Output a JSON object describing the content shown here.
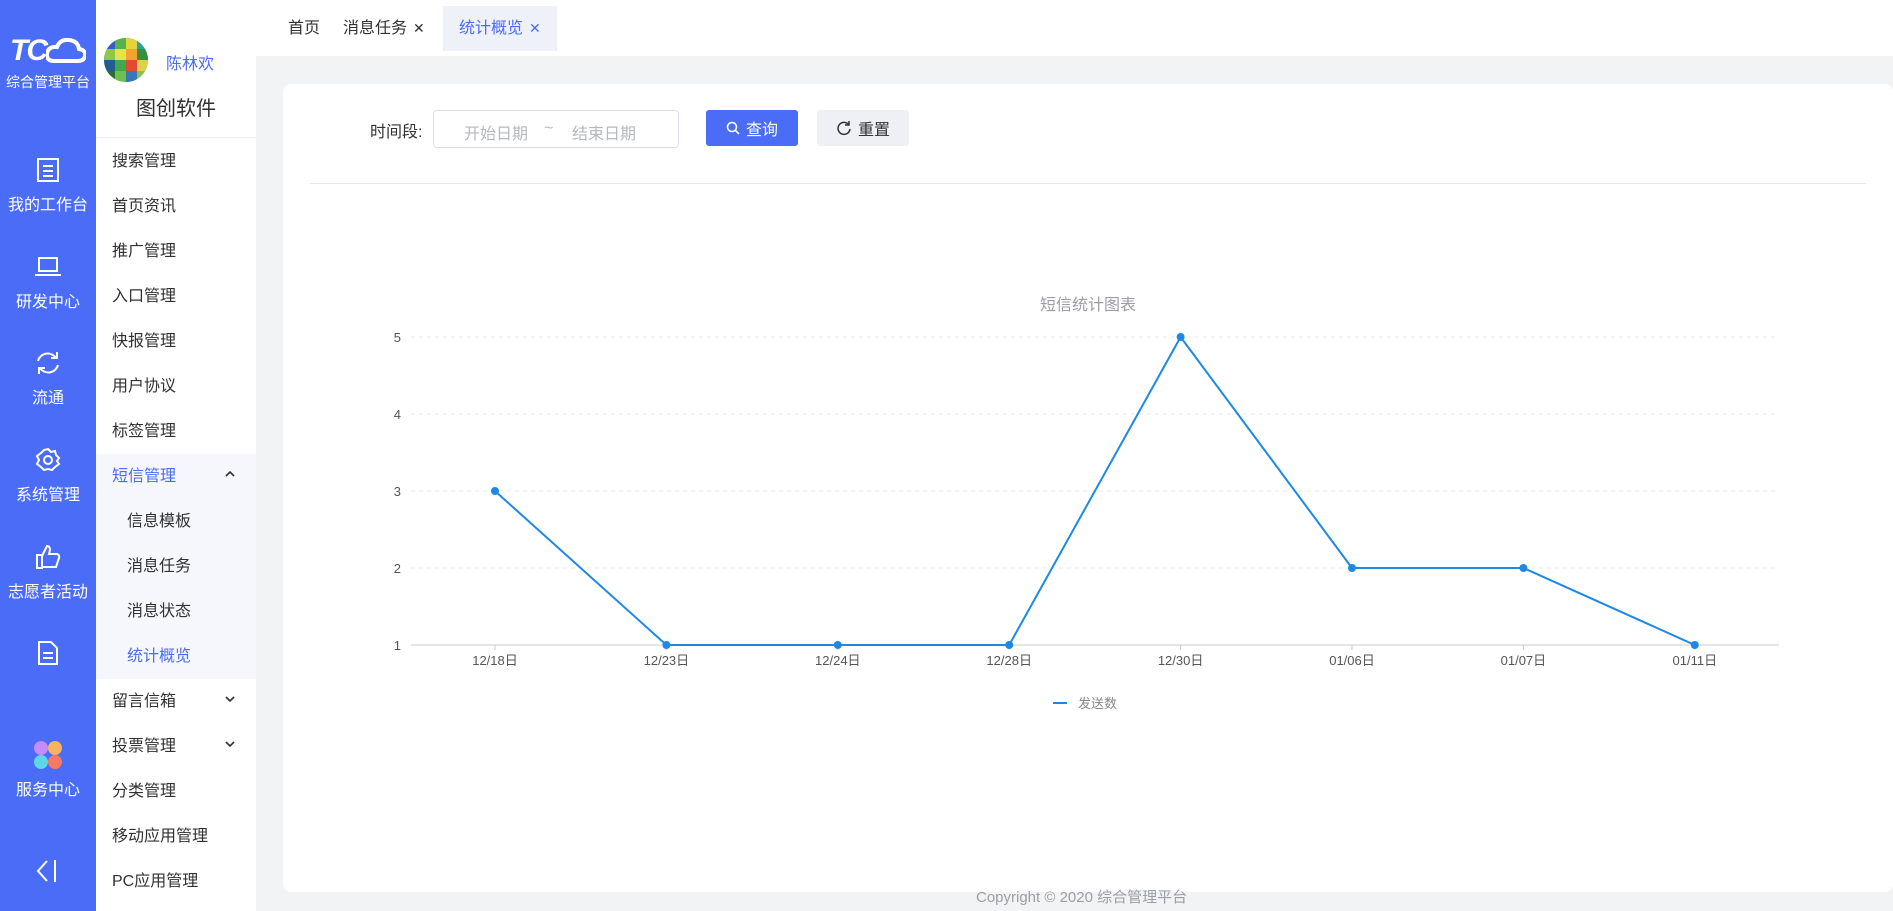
{
  "rail": {
    "logo_text": "TC",
    "app_name": "综合管理平台",
    "items": [
      {
        "label": "我的工作台",
        "icon": "dashboard-icon"
      },
      {
        "label": "研发中心",
        "icon": "laptop-icon"
      },
      {
        "label": "流通",
        "icon": "refresh-icon"
      },
      {
        "label": "系统管理",
        "icon": "gear-icon"
      },
      {
        "label": "志愿者活动",
        "icon": "thumbs-up-icon"
      },
      {
        "label": "",
        "icon": "document-icon"
      },
      {
        "label": "服务中心",
        "icon": "apps-icon"
      }
    ]
  },
  "user": {
    "name": "陈林欢",
    "company": "图创软件"
  },
  "menu": {
    "items": [
      {
        "label": "搜索管理"
      },
      {
        "label": "首页资讯"
      },
      {
        "label": "推广管理"
      },
      {
        "label": "入口管理"
      },
      {
        "label": "快报管理"
      },
      {
        "label": "用户协议"
      },
      {
        "label": "标签管理"
      },
      {
        "label": "短信管理",
        "state": "expanded"
      },
      {
        "label": "信息模板",
        "sub": true
      },
      {
        "label": "消息任务",
        "sub": true
      },
      {
        "label": "消息状态",
        "sub": true
      },
      {
        "label": "统计概览",
        "sub": true,
        "active": true
      },
      {
        "label": "留言信箱",
        "state": "collapsed"
      },
      {
        "label": "投票管理",
        "state": "collapsed"
      },
      {
        "label": "分类管理"
      },
      {
        "label": "移动应用管理"
      },
      {
        "label": "PC应用管理"
      }
    ]
  },
  "tabs": [
    {
      "label": "首页"
    },
    {
      "label": "消息任务",
      "closable": true
    },
    {
      "label": "统计概览",
      "closable": true,
      "active": true
    }
  ],
  "filter": {
    "label": "时间段:",
    "start_placeholder": "开始日期",
    "separator": "~",
    "end_placeholder": "结束日期",
    "query_label": "查询",
    "reset_label": "重置"
  },
  "chart_data": {
    "type": "line",
    "title": "短信统计图表",
    "categories": [
      "12/18日",
      "12/23日",
      "12/24日",
      "12/28日",
      "12/30日",
      "01/06日",
      "01/07日",
      "01/11日"
    ],
    "series": [
      {
        "name": "发送数",
        "values": [
          3,
          1,
          1,
          1,
          5,
          2,
          2,
          1
        ]
      }
    ],
    "ylim": [
      1,
      5
    ],
    "yticks": [
      "1",
      "2",
      "3",
      "4",
      "5"
    ],
    "grid": true,
    "legend": "bottom-center",
    "color": "#1e88e5"
  },
  "footer": {
    "copyright": "Copyright © 2020 综合管理平台"
  }
}
